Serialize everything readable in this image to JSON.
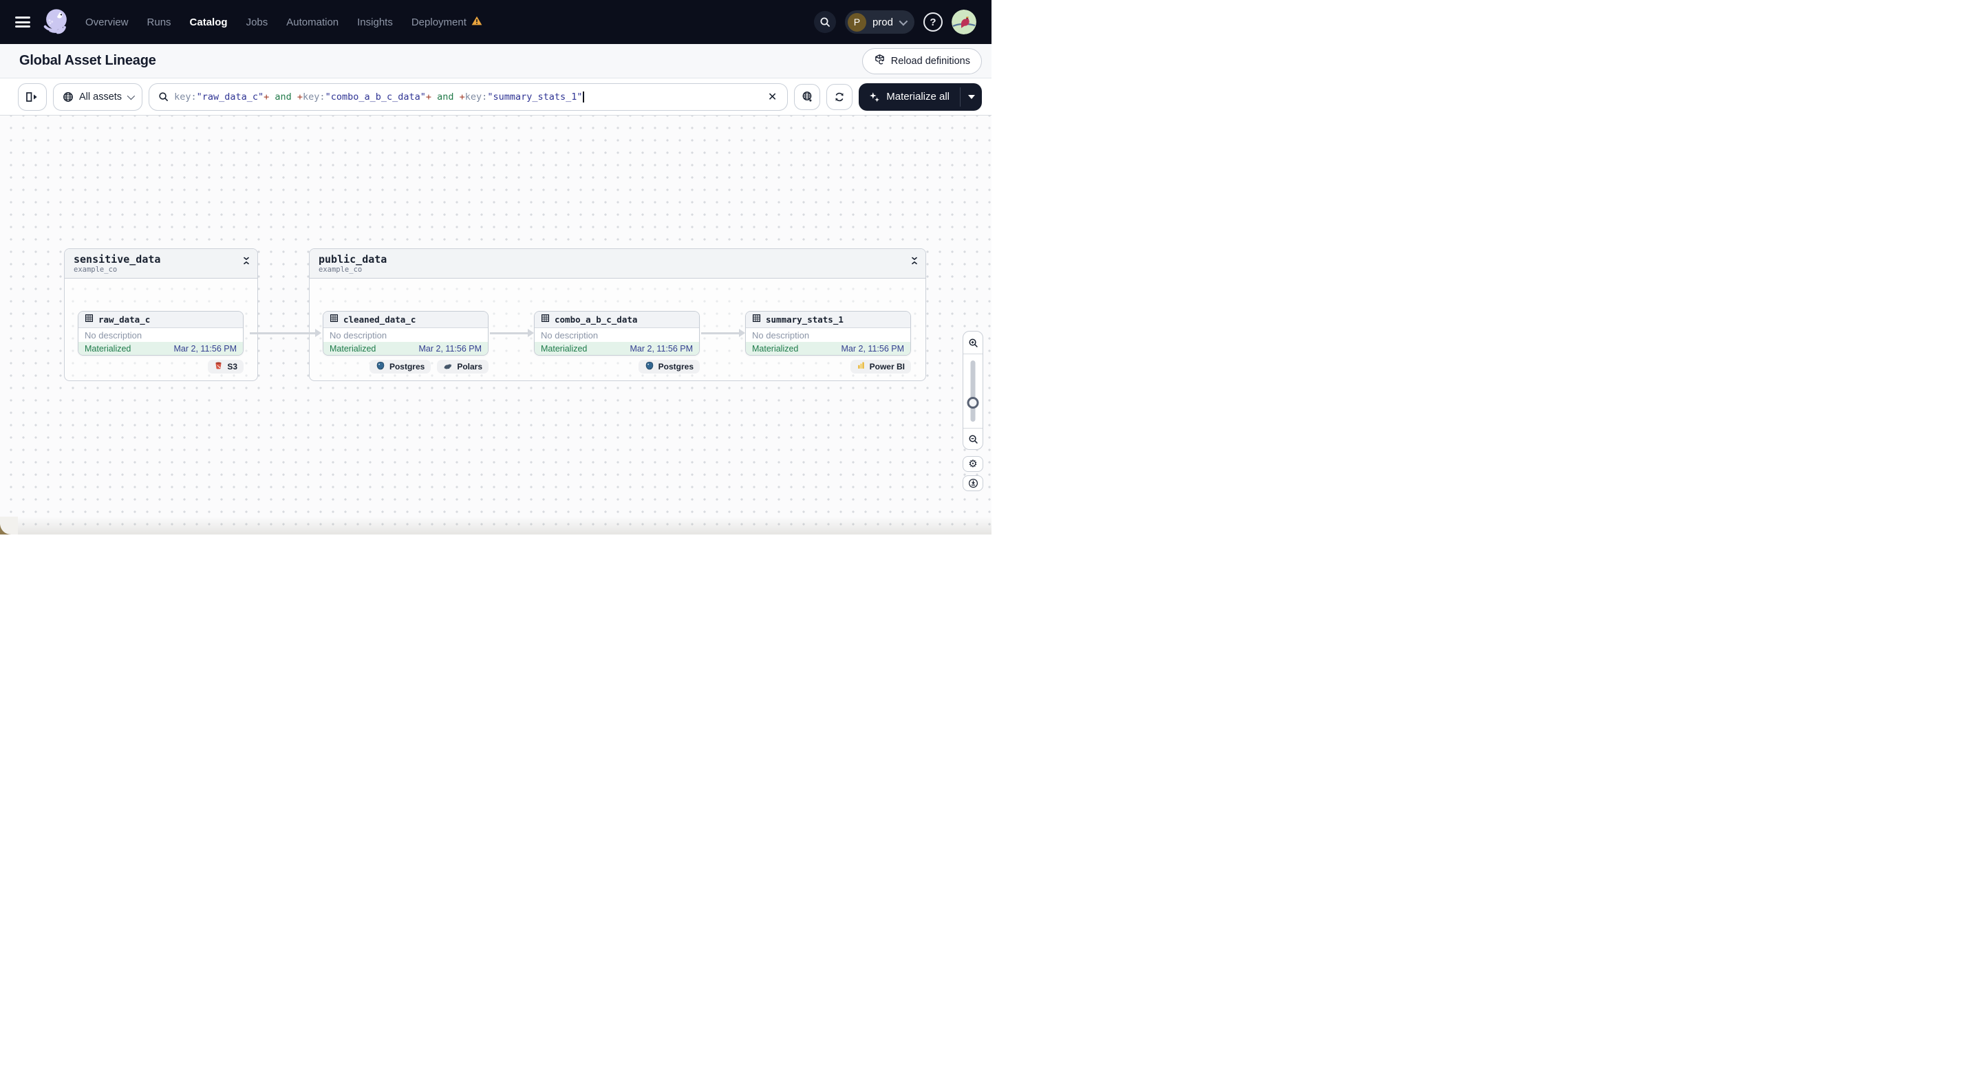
{
  "nav": {
    "items": [
      {
        "label": "Overview",
        "active": false,
        "warning": false
      },
      {
        "label": "Runs",
        "active": false,
        "warning": false
      },
      {
        "label": "Catalog",
        "active": true,
        "warning": false
      },
      {
        "label": "Jobs",
        "active": false,
        "warning": false
      },
      {
        "label": "Automation",
        "active": false,
        "warning": false
      },
      {
        "label": "Insights",
        "active": false,
        "warning": false
      },
      {
        "label": "Deployment",
        "active": false,
        "warning": true
      }
    ],
    "environment": {
      "initial": "P",
      "label": "prod"
    },
    "help_label": "?"
  },
  "header": {
    "title": "Global Asset Lineage",
    "reload_label": "Reload definitions"
  },
  "toolbar": {
    "scope_label": "All assets",
    "materialize_label": "Materialize all",
    "query": {
      "segments": [
        {
          "text": "key:",
          "color": "#7d89a0"
        },
        {
          "text": "\"raw_data_c\"",
          "color": "#2f3494"
        },
        {
          "text": "+",
          "color": "#a03a26"
        },
        {
          "text": " and ",
          "color": "#217a49"
        },
        {
          "text": "+",
          "color": "#a03a26"
        },
        {
          "text": "key:",
          "color": "#7d89a0"
        },
        {
          "text": "\"combo_a_b_c_data\"",
          "color": "#2f3494"
        },
        {
          "text": "+",
          "color": "#a03a26"
        },
        {
          "text": " and ",
          "color": "#217a49"
        },
        {
          "text": "+",
          "color": "#a03a26"
        },
        {
          "text": "key:",
          "color": "#7d89a0"
        },
        {
          "text": "\"summary_stats_1\"",
          "color": "#2f3494"
        }
      ]
    }
  },
  "graph": {
    "groups": [
      {
        "name": "sensitive_data",
        "repo": "example_co",
        "nodes": [
          {
            "name": "raw_data_c",
            "description": "No description",
            "status": "Materialized",
            "timestamp": "Mar 2, 11:56 PM",
            "badges": [
              {
                "label": "S3",
                "icon": "s3-bucket-icon"
              }
            ]
          }
        ]
      },
      {
        "name": "public_data",
        "repo": "example_co",
        "nodes": [
          {
            "name": "cleaned_data_c",
            "description": "No description",
            "status": "Materialized",
            "timestamp": "Mar 2, 11:56 PM",
            "badges": [
              {
                "label": "Postgres",
                "icon": "postgres-icon"
              },
              {
                "label": "Polars",
                "icon": "polars-icon"
              }
            ]
          },
          {
            "name": "combo_a_b_c_data",
            "description": "No description",
            "status": "Materialized",
            "timestamp": "Mar 2, 11:56 PM",
            "badges": [
              {
                "label": "Postgres",
                "icon": "postgres-icon"
              }
            ]
          },
          {
            "name": "summary_stats_1",
            "description": "No description",
            "status": "Materialized",
            "timestamp": "Mar 2, 11:56 PM",
            "badges": [
              {
                "label": "Power BI",
                "icon": "powerbi-icon"
              }
            ]
          }
        ]
      }
    ]
  },
  "colors": {
    "nav_bg": "#0b0e1b",
    "materialize_bg": "#141a2a",
    "status_green": "#1e7b4a",
    "status_bg": "#e4f3ea",
    "timestamp_blue": "#333f90",
    "warning_orange": "#e8a33d",
    "edge_gray": "#d2d6dc"
  }
}
